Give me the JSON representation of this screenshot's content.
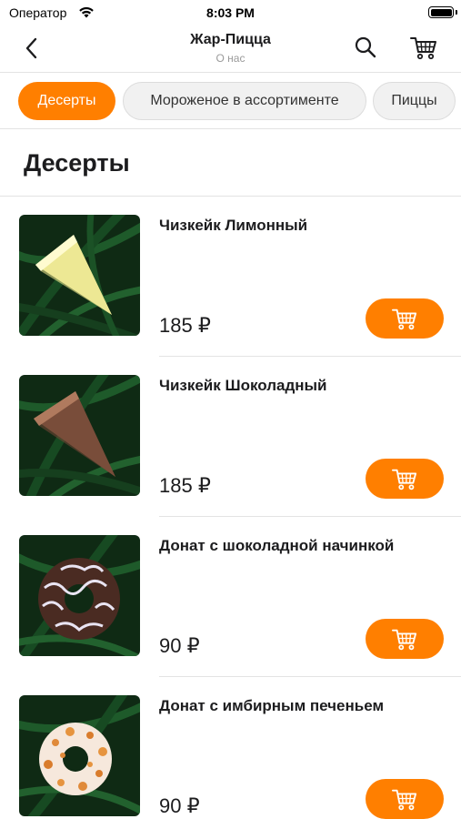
{
  "status_bar": {
    "carrier": "Оператор",
    "time": "8:03 PM"
  },
  "nav": {
    "title": "Жар-Пицца",
    "subtitle": "О нас",
    "icons": {
      "back": "chevron-left-icon",
      "search": "search-icon",
      "cart": "cart-icon"
    }
  },
  "tabs": [
    {
      "label": "Десерты",
      "active": true
    },
    {
      "label": "Мороженое в ассортименте",
      "active": false
    },
    {
      "label": "Пиццы",
      "active": false
    }
  ],
  "section": {
    "title": "Десерты"
  },
  "products": [
    {
      "name": "Чизкейк Лимонный",
      "price": "185 ₽",
      "image": "lemon-cheesecake"
    },
    {
      "name": "Чизкейк Шоколадный",
      "price": "185 ₽",
      "image": "chocolate-cheesecake"
    },
    {
      "name": "Донат с шоколадной начинкой",
      "price": "90 ₽",
      "image": "chocolate-donut"
    },
    {
      "name": "Донат с имбирным печеньем",
      "price": "90 ₽",
      "image": "gingerbread-donut"
    }
  ],
  "colors": {
    "accent": "#ff7f00",
    "leaf_background": "#0f2a14"
  }
}
